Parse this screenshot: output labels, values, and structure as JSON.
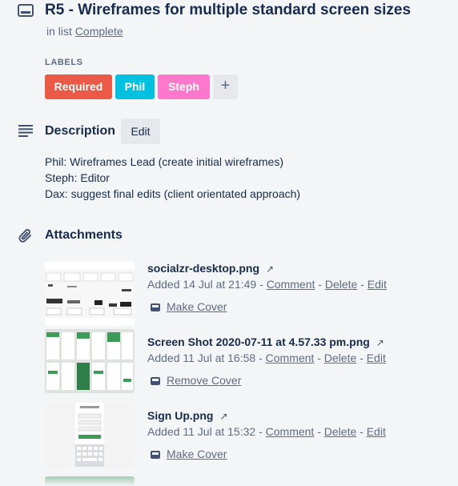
{
  "card": {
    "title": "R5 - Wireframes for multiple standard screen sizes",
    "in_list_prefix": "in list",
    "list_name": "Complete"
  },
  "labels": {
    "heading": "LABELS",
    "items": [
      {
        "text": "Required",
        "color": "#eb5a46"
      },
      {
        "text": "Phil",
        "color": "#00c2e0"
      },
      {
        "text": "Steph",
        "color": "#ff78cb"
      }
    ],
    "add_symbol": "+"
  },
  "description": {
    "heading": "Description",
    "edit_label": "Edit",
    "lines": [
      "Phil: Wireframes Lead (create initial wireframes)",
      "Steph: Editor",
      "Dax: suggest final edits (client orientated approach)"
    ]
  },
  "attachments": {
    "heading": "Attachments",
    "items": [
      {
        "name": "socialzr-desktop.png",
        "ext_symbol": "↗",
        "added": "Added 14 Jul at 21:49",
        "comment": "Comment",
        "delete": "Delete",
        "edit": "Edit",
        "cover_action": "Make Cover"
      },
      {
        "name": "Screen Shot 2020-07-11 at 4.57.33 pm.png",
        "ext_symbol": "↗",
        "added": "Added 11 Jul at 16:58",
        "comment": "Comment",
        "delete": "Delete",
        "edit": "Edit",
        "cover_action": "Remove Cover"
      },
      {
        "name": "Sign Up.png",
        "ext_symbol": "↗",
        "added": "Added 11 Jul at 15:32",
        "comment": "Comment",
        "delete": "Delete",
        "edit": "Edit",
        "cover_action": "Make Cover"
      }
    ],
    "separator": "-"
  },
  "icons": {
    "card": "card-icon",
    "description": "description-lines-icon",
    "attachment": "paperclip-icon",
    "cover": "cover-icon",
    "external": "external-link-icon"
  }
}
